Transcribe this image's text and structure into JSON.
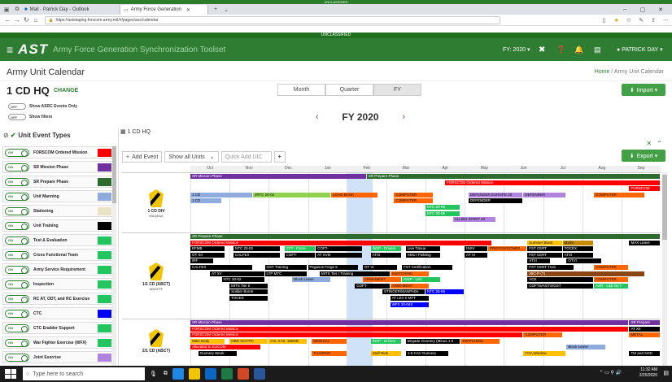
{
  "top_banner": "UNCLASSIFIED",
  "browser": {
    "tabs": [
      {
        "label": "Mail - Patrick Day - Outlook",
        "active": false
      },
      {
        "label": "Army Force Generation",
        "active": true
      }
    ],
    "url": "https://aststaging.forscom.army.mil/#/pages/auc/calendar"
  },
  "classification": "UNCLASSIFIED",
  "app": {
    "logo": "AST",
    "title": "Army Force Generation Synchronization Toolset",
    "fy_selector": "FY: 2020 ▾",
    "user": "PATRICK DAY ▾"
  },
  "page": {
    "title": "Army Unit Calendar",
    "breadcrumb_home": "Home",
    "breadcrumb_sep": " / ",
    "breadcrumb_current": "Army Unit Calendar"
  },
  "hq": {
    "title": "1 CD HQ",
    "change": "CHANGE",
    "import_label": "Import ▾",
    "export_label": "Export ▾"
  },
  "view_modes": [
    "Month",
    "Quarter",
    "FY"
  ],
  "active_view": "FY",
  "toggles": {
    "asrc": {
      "state": "OFF",
      "label": "Show ASRC Events Only"
    },
    "filters": {
      "state": "OFF",
      "label": "Show filters"
    }
  },
  "fiscal_year": "FY 2020",
  "sidebar": {
    "heading": "Unit Event Types",
    "items": [
      {
        "label": "FORSCOM Ordered Mission",
        "color": "#ff0000"
      },
      {
        "label": "SR Mission Phase",
        "color": "#7030a0"
      },
      {
        "label": "SR Prepare Phase",
        "color": "#2e6b2e"
      },
      {
        "label": "Unit Manning",
        "color": "#8faadc"
      },
      {
        "label": "Stationing",
        "color": "#e9e2c4"
      },
      {
        "label": "Unit Training",
        "color": "#000000"
      },
      {
        "label": "Test & Evaluation",
        "color": "#22c55e"
      },
      {
        "label": "Cross Functional Team",
        "color": "#22c55e"
      },
      {
        "label": "Army Service Requirement",
        "color": "#22c55e"
      },
      {
        "label": "Inspection",
        "color": "#22c55e"
      },
      {
        "label": "RC AT, ODT, and RC Exercise",
        "color": "#22c55e"
      },
      {
        "label": "CTC",
        "color": "#0000ff"
      },
      {
        "label": "CTC Enabler Support",
        "color": "#22c55e"
      },
      {
        "label": "War Fighter Exercise (WFX)",
        "color": "#22c55e"
      },
      {
        "label": "Joint Exercise",
        "color": "#b084e0"
      }
    ]
  },
  "calendar": {
    "header": "1 CD HQ",
    "add_event": "Add Event",
    "show_units": "Show all Units",
    "quick_add_placeholder": "Quick Add UIC",
    "months": [
      "Oct",
      "Nov",
      "Dec",
      "Jan",
      "Feb",
      "Mar",
      "Apr",
      "May",
      "Jun",
      "Jul",
      "Aug",
      "Sep"
    ],
    "units": [
      {
        "name": "1 CD DIV",
        "uic": "WAQEAA"
      },
      {
        "name": "1/1 CD (ABCT)",
        "uic": "WAGFFF"
      },
      {
        "name": "2/1 CD (ABCT)",
        "uic": ""
      }
    ],
    "events": [
      {
        "label": "SR Mission Phase",
        "unit": 0,
        "row": 0,
        "start": 0,
        "end": 4.5,
        "color": "#7030a0"
      },
      {
        "label": "SR Prepare Phase",
        "unit": 0,
        "row": 0,
        "start": 4.5,
        "end": 12,
        "color": "#2e6b2e"
      },
      {
        "label": "FORSCOM Ordered Mission",
        "unit": 0,
        "row": 1,
        "start": 6.5,
        "end": 12,
        "color": "#ff0000"
      },
      {
        "label": "FORSCOM",
        "unit": 0,
        "row": 2,
        "start": 11.2,
        "end": 12,
        "color": "#ff0000"
      },
      {
        "label": "1 CD",
        "unit": 0,
        "row": 3,
        "start": 0,
        "end": 1.6,
        "color": "#8faadc",
        "dark": true
      },
      {
        "label": "JRTC 20-02",
        "unit": 0,
        "row": 3,
        "start": 1.6,
        "end": 3.6,
        "color": "#92d050",
        "dark": true
      },
      {
        "label": "LOAD BANK",
        "unit": 0,
        "row": 3,
        "start": 3.6,
        "end": 4.8,
        "color": "#ff6600",
        "dark": true
      },
      {
        "label": "COMPUTER",
        "unit": 0,
        "row": 3,
        "start": 5.2,
        "end": 6.2,
        "color": "#ff6600",
        "dark": true
      },
      {
        "label": "DEFENDER EUROPE 20",
        "unit": 0,
        "row": 3,
        "start": 7.1,
        "end": 8.5,
        "color": "#b084e0",
        "dark": true
      },
      {
        "label": "DEFENDER",
        "unit": 0,
        "row": 3,
        "start": 8.5,
        "end": 9.6,
        "color": "#b084e0",
        "dark": true
      },
      {
        "label": "COMPUTER",
        "unit": 0,
        "row": 3,
        "start": 10.3,
        "end": 11.6,
        "color": "#ff6600",
        "dark": true
      },
      {
        "label": "1 CD",
        "unit": 0,
        "row": 4,
        "start": 0,
        "end": 0.8,
        "color": "#8faadc",
        "dark": true
      },
      {
        "label": "COMPUTER",
        "unit": 0,
        "row": 4,
        "start": 5.2,
        "end": 6.2,
        "color": "#ff6600",
        "dark": true
      },
      {
        "label": "DEFENDER",
        "unit": 0,
        "row": 4,
        "start": 7.1,
        "end": 8.5,
        "color": "#000000"
      },
      {
        "label": "NTC 20-06",
        "unit": 0,
        "row": 5,
        "start": 6.0,
        "end": 6.9,
        "color": "#22c55e"
      },
      {
        "label": "NTC 20-06",
        "unit": 0,
        "row": 6,
        "start": 6.0,
        "end": 6.9,
        "color": "#22c55e"
      },
      {
        "label": "ALLIED SPIRIT 20",
        "unit": 0,
        "row": 7,
        "start": 6.7,
        "end": 7.8,
        "color": "#b084e0",
        "dark": true
      },
      {
        "label": "SR Prepare Phase",
        "unit": 1,
        "row": 0,
        "start": 0,
        "end": 12,
        "color": "#2e6b2e"
      },
      {
        "label": "FORSCOM Ordered Mission",
        "unit": 1,
        "row": 1,
        "start": 0,
        "end": 7.7,
        "color": "#ff0000"
      },
      {
        "label": "Summer Block",
        "unit": 1,
        "row": 1,
        "start": 8.6,
        "end": 9.5,
        "color": "#ffc000",
        "dark": true
      },
      {
        "label": "M249",
        "unit": 1,
        "row": 1,
        "start": 9.5,
        "end": 10.3,
        "color": "#c68b00",
        "dark": true
      },
      {
        "label": "MAX Leave",
        "unit": 1,
        "row": 1,
        "start": 11.2,
        "end": 12,
        "color": "#000000"
      },
      {
        "label": "EFMB",
        "unit": 1,
        "row": 2,
        "start": 0,
        "end": 0.9,
        "color": "#000000"
      },
      {
        "label": "NTC 20-02",
        "unit": 1,
        "row": 2,
        "start": 1.1,
        "end": 2.3,
        "color": "#000000"
      },
      {
        "label": "CFT - Force",
        "unit": 1,
        "row": 2,
        "start": 2.4,
        "end": 3.2,
        "color": "#22c55e"
      },
      {
        "label": "COFT-",
        "unit": 1,
        "row": 2,
        "start": 3.2,
        "end": 4.4,
        "color": "#000000"
      },
      {
        "label": "INSP - Drivers",
        "unit": 1,
        "row": 2,
        "start": 4.6,
        "end": 5.4,
        "color": "#22c55e"
      },
      {
        "label": "Live Tissue",
        "unit": 1,
        "row": 2,
        "start": 5.5,
        "end": 6.4,
        "color": "#000000"
      },
      {
        "label": "INSV",
        "unit": 1,
        "row": 2,
        "start": 7.0,
        "end": 7.6,
        "color": "#000000"
      },
      {
        "label": "PREPOSITIONED",
        "unit": 1,
        "row": 2,
        "start": 7.6,
        "end": 8.6,
        "color": "#ff6600",
        "dark": true
      },
      {
        "label": "FST CERT",
        "unit": 1,
        "row": 2,
        "start": 8.6,
        "end": 9.5,
        "color": "#000000"
      },
      {
        "label": "TOCEX",
        "unit": 1,
        "row": 2,
        "start": 9.5,
        "end": 10.3,
        "color": "#000000"
      },
      {
        "label": "OT XII",
        "unit": 1,
        "row": 3,
        "start": 0,
        "end": 0.9,
        "color": "#000000"
      },
      {
        "label": "CALFEX",
        "unit": 1,
        "row": 3,
        "start": 1.1,
        "end": 2.3,
        "color": "#000000"
      },
      {
        "label": "COFT-",
        "unit": 1,
        "row": 3,
        "start": 2.4,
        "end": 3.2,
        "color": "#000000"
      },
      {
        "label": "AT XVIII",
        "unit": 1,
        "row": 3,
        "start": 3.2,
        "end": 4.4,
        "color": "#000000"
      },
      {
        "label": "ATXI",
        "unit": 1,
        "row": 3,
        "start": 4.6,
        "end": 5.4,
        "color": "#000000"
      },
      {
        "label": "XM17 Fielding",
        "unit": 1,
        "row": 3,
        "start": 5.5,
        "end": 6.4,
        "color": "#000000"
      },
      {
        "label": "AT VI",
        "unit": 1,
        "row": 3,
        "start": 7.0,
        "end": 7.6,
        "color": "#000000"
      },
      {
        "label": "FST CERT",
        "unit": 1,
        "row": 3,
        "start": 8.6,
        "end": 9.5,
        "color": "#000000"
      },
      {
        "label": "ATXI",
        "unit": 1,
        "row": 3,
        "start": 9.5,
        "end": 10.3,
        "color": "#000000"
      },
      {
        "label": "IRF",
        "unit": 1,
        "row": 4,
        "start": 0,
        "end": 0.6,
        "color": "#000000"
      },
      {
        "label": "ATXI",
        "unit": 1,
        "row": 4,
        "start": 8.6,
        "end": 9.2,
        "color": "#000000"
      },
      {
        "label": "OTVI",
        "unit": 1,
        "row": 4,
        "start": 9.6,
        "end": 10.5,
        "color": "#000000"
      },
      {
        "label": "CALFEX",
        "unit": 1,
        "row": 5,
        "start": 0,
        "end": 1.6,
        "color": "#000000"
      },
      {
        "label": "OST Training",
        "unit": 1,
        "row": 5,
        "start": 1.9,
        "end": 3.0,
        "color": "#000000"
      },
      {
        "label": "Pegasus Forge 5",
        "unit": 1,
        "row": 5,
        "start": 3.0,
        "end": 4.3,
        "color": "#000000"
      },
      {
        "label": "OT VI",
        "unit": 1,
        "row": 5,
        "start": 4.4,
        "end": 5.3,
        "color": "#000000"
      },
      {
        "label": "FST Certification",
        "unit": 1,
        "row": 5,
        "start": 5.4,
        "end": 6.7,
        "color": "#000000"
      },
      {
        "label": "FST CERT Train",
        "unit": 1,
        "row": 5,
        "start": 8.6,
        "end": 9.8,
        "color": "#000000"
      },
      {
        "label": "COMPUTER",
        "unit": 1,
        "row": 5,
        "start": 10.3,
        "end": 11.2,
        "color": "#ff6600",
        "dark": true
      },
      {
        "label": "AT XV",
        "unit": 1,
        "row": 6,
        "start": 0.5,
        "end": 1.9,
        "color": "#000000"
      },
      {
        "label": "LTP MTC",
        "unit": 1,
        "row": 6,
        "start": 1.9,
        "end": 3.0,
        "color": "#000000"
      },
      {
        "label": "MITS Tier I Training",
        "unit": 1,
        "row": 6,
        "start": 3.3,
        "end": 5.1,
        "color": "#000000"
      },
      {
        "label": "SWITCHING",
        "unit": 1,
        "row": 6,
        "start": 5.1,
        "end": 6.1,
        "color": "#ff6600",
        "dark": true
      },
      {
        "label": "JBC-P (T)",
        "unit": 1,
        "row": 6,
        "start": 8.6,
        "end": 11.6,
        "color": "#8b4513"
      },
      {
        "label": "NTC 20-02",
        "unit": 1,
        "row": 7,
        "start": 0.8,
        "end": 1.9,
        "color": "#000000"
      },
      {
        "label": "Block Leave",
        "unit": 1,
        "row": 7,
        "start": 2.6,
        "end": 3.6,
        "color": "#8faadc",
        "dark": true
      },
      {
        "label": "ARMAMENT",
        "unit": 1,
        "row": 7,
        "start": 4.4,
        "end": 5.4,
        "color": "#ff6600",
        "dark": true
      },
      {
        "label": "INSP - Unit",
        "unit": 1,
        "row": 7,
        "start": 5.4,
        "end": 6.4,
        "color": "#22c55e"
      },
      {
        "label": "VCE",
        "unit": 1,
        "row": 7,
        "start": 8.6,
        "end": 10.3,
        "color": "#000000"
      },
      {
        "label": "COMPUTER",
        "unit": 1,
        "row": 7,
        "start": 10.3,
        "end": 11.2,
        "color": "#ff6600",
        "dark": true
      },
      {
        "label": "MITS Tier II",
        "unit": 1,
        "row": 8,
        "start": 1.0,
        "end": 2.0,
        "color": "#000000"
      },
      {
        "label": "COFT-",
        "unit": 1,
        "row": 8,
        "start": 4.2,
        "end": 5.1,
        "color": "#000000"
      },
      {
        "label": "ARMAMENT",
        "unit": 1,
        "row": 8,
        "start": 5.1,
        "end": 6.1,
        "color": "#ff6600",
        "dark": true
      },
      {
        "label": "COFTS/AGTS/GST",
        "unit": 1,
        "row": 8,
        "start": 8.6,
        "end": 10.3,
        "color": "#000000"
      },
      {
        "label": "ASR - L&E BCT",
        "unit": 1,
        "row": 8,
        "start": 10.3,
        "end": 11.2,
        "color": "#22c55e"
      },
      {
        "label": "Soldier Borne",
        "unit": 1,
        "row": 9,
        "start": 1.0,
        "end": 2.0,
        "color": "#000000"
      },
      {
        "label": "STINGER/MANPADs",
        "unit": 1,
        "row": 9,
        "start": 4.9,
        "end": 6.0,
        "color": "#000000"
      },
      {
        "label": "NTC 20-06",
        "unit": 1,
        "row": 9,
        "start": 6.0,
        "end": 7.0,
        "color": "#0000ff"
      },
      {
        "label": "TOCES",
        "unit": 1,
        "row": 10,
        "start": 1.0,
        "end": 2.0,
        "color": "#000000"
      },
      {
        "label": "AT LEV II MTT",
        "unit": 1,
        "row": 10,
        "start": 5.1,
        "end": 6.1,
        "color": "#000000"
      },
      {
        "label": "WFX 20-04X",
        "unit": 1,
        "row": 11,
        "start": 5.1,
        "end": 6.1,
        "color": "#0000ff"
      },
      {
        "label": "SR Mission Phase",
        "unit": 2,
        "row": 0,
        "start": 0,
        "end": 11.2,
        "color": "#7030a0"
      },
      {
        "label": "SR Prepare",
        "unit": 2,
        "row": 0,
        "start": 11.2,
        "end": 12,
        "color": "#7030a0"
      },
      {
        "label": "FORSCOM Ordered Mission",
        "unit": 2,
        "row": 1,
        "start": 0,
        "end": 11.2,
        "color": "#ff0000"
      },
      {
        "label": "AT XII",
        "unit": 2,
        "row": 1,
        "start": 11.2,
        "end": 12,
        "color": "#000000"
      },
      {
        "label": "FORSCOM Ordered Mission",
        "unit": 2,
        "row": 2,
        "start": 0,
        "end": 8.5,
        "color": "#ff0000"
      },
      {
        "label": "COMPUTER",
        "unit": 2,
        "row": 2,
        "start": 8.5,
        "end": 9.5,
        "color": "#ff6600",
        "dark": true
      },
      {
        "label": "METAL",
        "unit": 2,
        "row": 2,
        "start": 11.2,
        "end": 12,
        "color": "#ff6600",
        "dark": true
      },
      {
        "label": "Main Body",
        "unit": 2,
        "row": 3,
        "start": 0,
        "end": 0.9,
        "color": "#ffc000",
        "dark": true
      },
      {
        "label": "OBR XIII FPC",
        "unit": 2,
        "row": 3,
        "start": 1.0,
        "end": 2.0,
        "color": "#ffc000",
        "dark": true
      },
      {
        "label": "4-8, 3-16, 15BSB",
        "unit": 2,
        "row": 3,
        "start": 2.0,
        "end": 3.0,
        "color": "#ffc000",
        "dark": true
      },
      {
        "label": "MEDICAL",
        "unit": 2,
        "row": 3,
        "start": 3.1,
        "end": 4.0,
        "color": "#ff6600",
        "dark": true
      },
      {
        "label": "INSP - Drivers",
        "unit": 2,
        "row": 3,
        "start": 4.6,
        "end": 5.4,
        "color": "#22c55e"
      },
      {
        "label": "Brigade Gunnery (Minus 1-5",
        "unit": 2,
        "row": 3,
        "start": 5.5,
        "end": 6.9,
        "color": "#000000"
      },
      {
        "label": "SWITCHING",
        "unit": 2,
        "row": 3,
        "start": 6.9,
        "end": 7.9,
        "color": "#ff6600",
        "dark": true
      },
      {
        "label": "Allocated to EUCOM",
        "unit": 2,
        "row": 4,
        "start": 0,
        "end": 1.8,
        "color": "#ff0000"
      },
      {
        "label": "Block Leave",
        "unit": 2,
        "row": 4,
        "start": 9.6,
        "end": 10.6,
        "color": "#8faadc",
        "dark": true
      },
      {
        "label": "Gunnery Week",
        "unit": 2,
        "row": 5,
        "start": 0.2,
        "end": 1.2,
        "color": "#000000"
      },
      {
        "label": "THAWING",
        "unit": 2,
        "row": 5,
        "start": 3.1,
        "end": 4.0,
        "color": "#ff6600",
        "dark": true
      },
      {
        "label": "Staff Ride",
        "unit": 2,
        "row": 5,
        "start": 4.6,
        "end": 5.4,
        "color": "#ffc000",
        "dark": true
      },
      {
        "label": "1-5 CAV Gunnery",
        "unit": 2,
        "row": 5,
        "start": 5.5,
        "end": 6.6,
        "color": "#000000"
      },
      {
        "label": "TOA Window",
        "unit": 2,
        "row": 5,
        "start": 8.5,
        "end": 9.6,
        "color": "#ffc000",
        "dark": true
      },
      {
        "label": "TM and SGD",
        "unit": 2,
        "row": 5,
        "start": 11.2,
        "end": 12,
        "color": "#000000"
      }
    ]
  },
  "taskbar": {
    "search_placeholder": "Type here to search",
    "time": "11:32 AM",
    "date": "2/25/2020"
  }
}
